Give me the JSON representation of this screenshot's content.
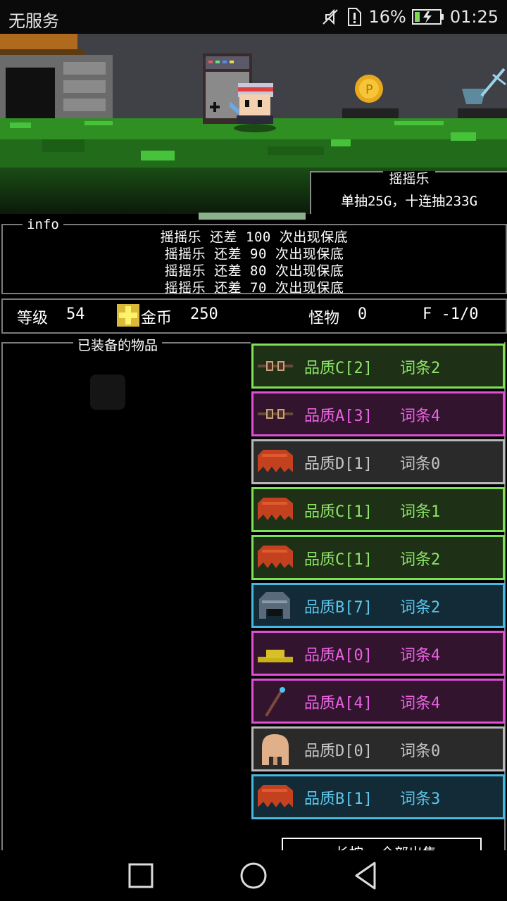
{
  "status_bar": {
    "carrier": "无服务",
    "battery_percent": "16%",
    "time": "01:25",
    "icons": [
      "mute-icon",
      "sim-alert-icon",
      "battery-charging-icon"
    ]
  },
  "scene": {
    "gacha": {
      "title": "摇摇乐",
      "price": "单抽25G，十连抽233G"
    }
  },
  "info": {
    "title": "info",
    "lines": [
      "摇摇乐 还差 100 次出现保底",
      "摇摇乐 还差 90 次出现保底",
      "摇摇乐 还差 80 次出现保底",
      "摇摇乐 还差 70 次出现保底"
    ]
  },
  "stats": {
    "level_label": "等级",
    "level_value": "54",
    "gold_label": "金币",
    "gold_value": "250",
    "monster_label": "怪物",
    "monster_value": "0",
    "floor": "F -1/0"
  },
  "equipped": {
    "title": "已装备的物品"
  },
  "items": [
    {
      "icon": "goggles-icon",
      "quality": "品质C[2]",
      "affix": "词条2",
      "tier": "C"
    },
    {
      "icon": "goggles-icon",
      "quality": "品质A[3]",
      "affix": "词条4",
      "tier": "A"
    },
    {
      "icon": "hair-icon",
      "quality": "品质D[1]",
      "affix": "词条0",
      "tier": "D"
    },
    {
      "icon": "hair-icon",
      "quality": "品质C[1]",
      "affix": "词条1",
      "tier": "C"
    },
    {
      "icon": "hair-icon",
      "quality": "品质C[1]",
      "affix": "词条2",
      "tier": "C"
    },
    {
      "icon": "helmet-icon",
      "quality": "品质B[7]",
      "affix": "词条2",
      "tier": "B"
    },
    {
      "icon": "straw-hat-icon",
      "quality": "品质A[0]",
      "affix": "词条4",
      "tier": "A"
    },
    {
      "icon": "magic-wand-icon",
      "quality": "品质A[4]",
      "affix": "词条4",
      "tier": "A"
    },
    {
      "icon": "bald-head-icon",
      "quality": "品质D[0]",
      "affix": "词条0",
      "tier": "D"
    },
    {
      "icon": "hair-icon",
      "quality": "品质B[1]",
      "affix": "词条3",
      "tier": "B"
    }
  ],
  "tier_colors": {
    "C": {
      "border": "#7fe05a",
      "bg": "#1e3116",
      "text": "#8ee56a"
    },
    "A": {
      "border": "#e04fd6",
      "bg": "#32142f",
      "text": "#ea63e0"
    },
    "D": {
      "border": "#b9b9b9",
      "bg": "#2a2a2a",
      "text": "#c6c6c6"
    },
    "B": {
      "border": "#48b8e0",
      "bg": "#122b36",
      "text": "#5cc6ec"
    }
  },
  "sell_button": {
    "label": "<长按> 全部出售"
  },
  "nav": [
    "recent-apps-button",
    "home-button",
    "back-button"
  ]
}
